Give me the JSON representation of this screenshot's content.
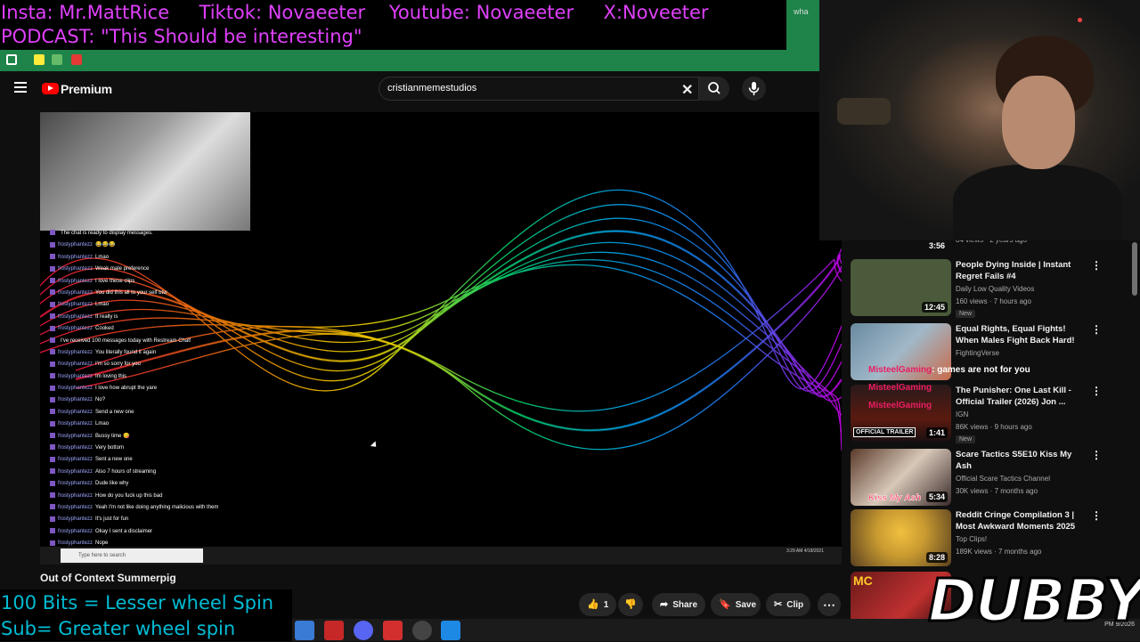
{
  "overlay": {
    "top_line1": "Insta: Mr.MattRice     Tiktok: Novaeeter    Youtube: Novaeeter     X:Noveeter",
    "top_line2": "PODCAST: \"This Should be interesting\"",
    "bottom_line1": "100 Bits = Lesser wheel Spin",
    "bottom_line2": "Sub= Greater wheel spin",
    "logo": "DUBBY"
  },
  "browser": {
    "tab_partial": "wha",
    "extension_colors": [
      "#ffffff",
      "#ffeb3b",
      "#66bb6a",
      "#e53935"
    ]
  },
  "header": {
    "logo_label": "Premium",
    "search_value": "cristianmemestudios"
  },
  "video": {
    "title": "Out of Context Summerpig",
    "likes": "1",
    "share_label": "Share",
    "save_label": "Save",
    "clip_label": "Clip",
    "inner_chat": [
      {
        "user": "",
        "msg": "The chat is ready to display messages."
      },
      {
        "user": "frostyphantezz",
        "msg": "😂😂😂"
      },
      {
        "user": "frostyphantezz",
        "msg": "Lmao"
      },
      {
        "user": "frostyphantezz",
        "msg": "Weak male preference"
      },
      {
        "user": "frostyphantezz",
        "msg": "I love these clips"
      },
      {
        "user": "frostyphantezz",
        "msg": "You did this all to your self btw"
      },
      {
        "user": "frostyphantezz",
        "msg": "Lmao"
      },
      {
        "user": "frostyphantezz",
        "msg": "It really is"
      },
      {
        "user": "frostyphantezz",
        "msg": "Cooked"
      },
      {
        "user": "",
        "msg": "I've received 100 messages today with Restream Chat!"
      },
      {
        "user": "frostyphantezz",
        "msg": "You literally found it again"
      },
      {
        "user": "frostyphantezz",
        "msg": "I'm so sorry for you"
      },
      {
        "user": "frostyphantezz",
        "msg": "Im loving this"
      },
      {
        "user": "frostyphantezz",
        "msg": "I love how abrupt the yare"
      },
      {
        "user": "frostyphantezz",
        "msg": "No?"
      },
      {
        "user": "frostyphantezz",
        "msg": "Send a new one"
      },
      {
        "user": "frostyphantezz",
        "msg": "Lmao"
      },
      {
        "user": "frostyphantezz",
        "msg": "Bussy time 😋"
      },
      {
        "user": "frostyphantezz",
        "msg": "Very bottom"
      },
      {
        "user": "frostyphantezz",
        "msg": "Sent a new one"
      },
      {
        "user": "frostyphantezz",
        "msg": "Also 7 hours of streaming"
      },
      {
        "user": "frostyphantezz",
        "msg": "Dude like why"
      },
      {
        "user": "frostyphantezz",
        "msg": "How do you fuck up this bad"
      },
      {
        "user": "frostyphantezz",
        "msg": "Yeah I'm not like doing anything malicious with them"
      },
      {
        "user": "frostyphantezz",
        "msg": "It's just for fun"
      },
      {
        "user": "frostyphantezz",
        "msg": "Okay I sent a disclaimer"
      },
      {
        "user": "frostyphantezz",
        "msg": "Nope"
      }
    ],
    "inner_taskbar_search": "Type here to search",
    "inner_clock": "3:29 AM\n4/18/2021"
  },
  "sidebar": {
    "partial_meta": "84 views · 2 years ago",
    "partial_duration": "3:56",
    "items": [
      {
        "title": "People Dying Inside | Instant Regret Fails #4",
        "channel": "Daily Low Quality Videos",
        "meta": "160 views · 7 hours ago",
        "badge": "New",
        "duration": "12:45",
        "thumb": "#4a5a3a"
      },
      {
        "title": "Equal Rights, Equal Fights! When Males Fight Back Hard!",
        "channel": "FightingVerse",
        "meta": "",
        "badge": "",
        "duration": "",
        "thumb": "#6a8aa0"
      },
      {
        "title": "The Punisher: One Last Kill - Official Trailer (2026) Jon ...",
        "channel": "IGN",
        "meta": "86K views · 9 hours ago",
        "badge": "New",
        "duration": "1:41",
        "thumb": "#3a1a1a",
        "thumb_label": "OFFICIAL TRAILER"
      },
      {
        "title": "Scare Tactics S5E10 Kiss My Ash",
        "channel": "Official Scare Tactics Channel",
        "meta": "30K views · 7 months ago",
        "badge": "",
        "duration": "5:34",
        "thumb": "#5a3a2a",
        "thumb_label": "Kiss My Ash"
      },
      {
        "title": "Reddit Cringe Compilation 3 | Most Awkward Moments 2025",
        "channel": "Top Clips!",
        "meta": "189K views · 7 months ago",
        "badge": "",
        "duration": "8:28",
        "thumb": "#c89a30"
      },
      {
        "title": "",
        "channel": "",
        "meta": "",
        "badge": "",
        "duration": "",
        "thumb": "#6a1a1a",
        "thumb_label": "MC"
      }
    ]
  },
  "stream_chat_overlay": [
    {
      "name": "MisteelGaming",
      "msg": ": games are not for you"
    },
    {
      "name": "MisteelGaming",
      "msg": ""
    },
    {
      "name": "MisteelGaming",
      "msg": ""
    }
  ],
  "taskbar": {
    "clock": "PM\n9/2026",
    "app_colors": [
      "#3a7bd5",
      "#c62828",
      "#5865f2",
      "#d32f2f",
      "#444444",
      "#1e88e5"
    ]
  }
}
